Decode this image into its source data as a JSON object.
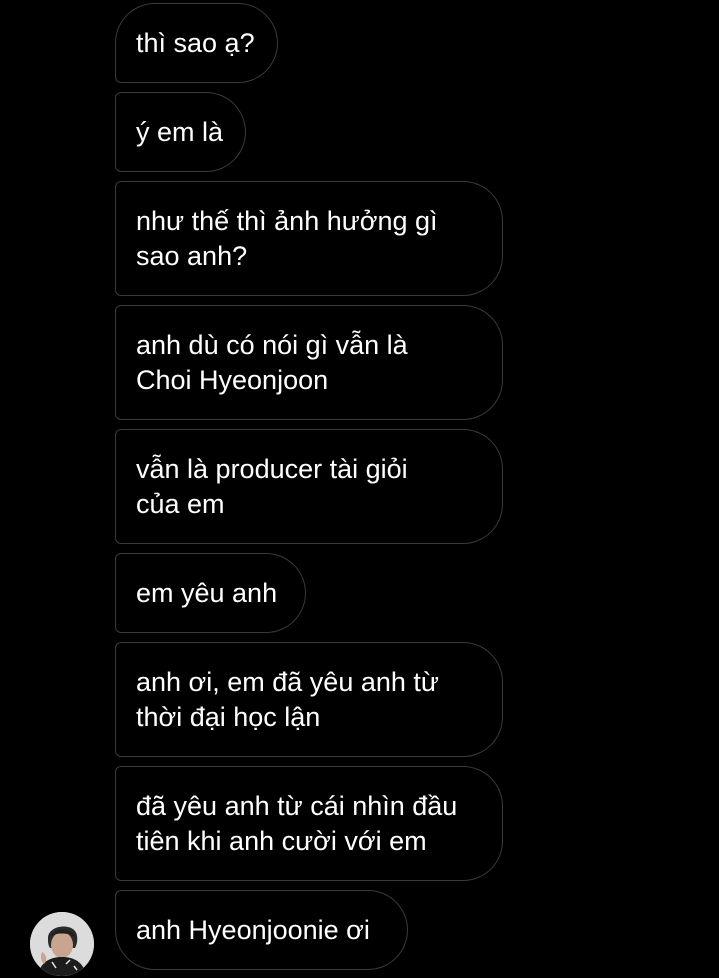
{
  "messages": [
    {
      "text": "thì sao ạ?"
    },
    {
      "text": "ý em là"
    },
    {
      "text": "như thế thì ảnh hưởng gì\nsao anh?"
    },
    {
      "text": "anh dù có nói gì vẫn là\nChoi Hyeonjoon"
    },
    {
      "text": "vẫn là producer tài giỏi\ncủa em"
    },
    {
      "text": "em yêu anh"
    },
    {
      "text": "anh ơi, em đã yêu anh từ\nthời đại học lận"
    },
    {
      "text": "đã yêu anh từ cái nhìn đầu\ntiên khi anh cười với em"
    },
    {
      "text": "anh Hyeonjoonie ơi"
    }
  ],
  "colors": {
    "background": "#000000",
    "bubble_border": "#3a3a3a",
    "text": "#ffffff"
  },
  "icons": {
    "avatar": "profile-photo-avatar"
  }
}
